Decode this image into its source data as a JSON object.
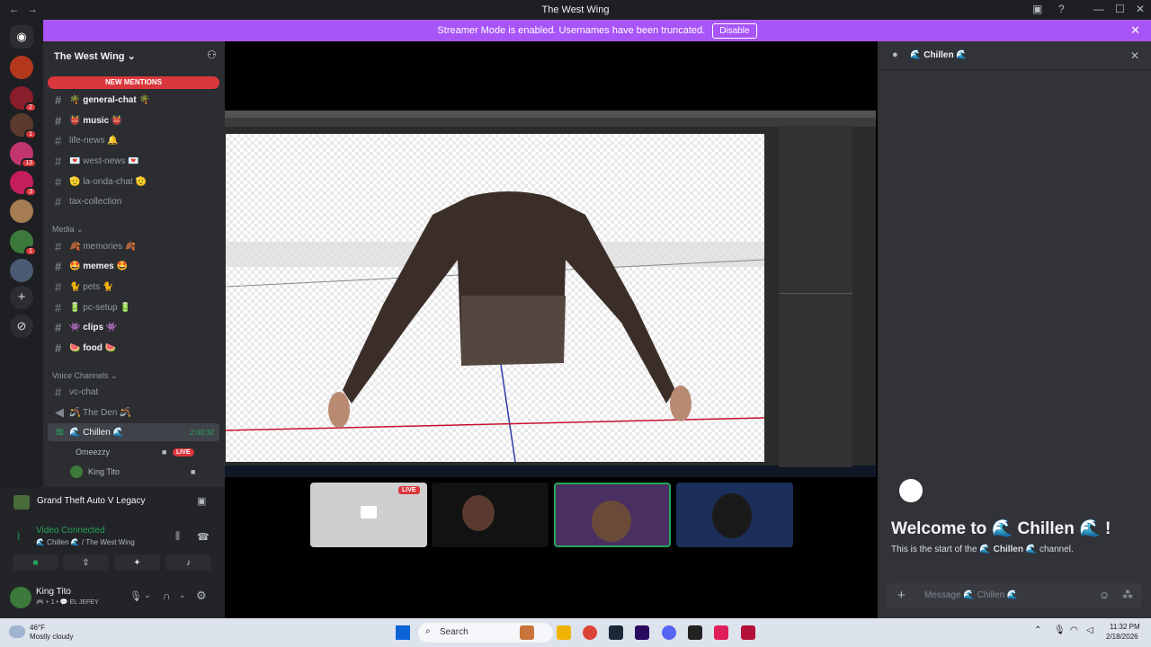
{
  "window": {
    "title": "The West Wing"
  },
  "banner": {
    "text": "Streamer Mode is enabled. Usernames have been truncated.",
    "button": "Disable"
  },
  "server": {
    "name": "The West Wing"
  },
  "new_mentions": "NEW MENTIONS",
  "channels": [
    {
      "name": "🌴 general-chat 🌴",
      "unread": true
    },
    {
      "name": "👹 music 👹",
      "unread": true
    },
    {
      "name": "life-news 🔔",
      "unread": false
    },
    {
      "name": "💌 west-news 💌",
      "unread": false
    },
    {
      "name": "🫡 la-onda-chat 🫡",
      "unread": false
    },
    {
      "name": "tax-collection",
      "unread": false
    }
  ],
  "media_category": "Media",
  "media_channels": [
    {
      "name": "🍂 memories 🍂",
      "unread": false
    },
    {
      "name": "🤩 memes 🤩",
      "unread": true
    },
    {
      "name": "🐈 pets 🐈",
      "unread": false
    },
    {
      "name": "🔋 pc-setup 🔋",
      "unread": false
    },
    {
      "name": "👾 clips 👾",
      "unread": true
    },
    {
      "name": "🍉 food 🍉",
      "unread": true
    }
  ],
  "voice_category": "Voice Channels",
  "voice_channels": [
    {
      "name": "vc-chat"
    },
    {
      "name": "🪃 The Den 🪃"
    },
    {
      "name": "🌊 Chillen 🌊",
      "timer": "2:00:32"
    }
  ],
  "voice_users": [
    {
      "name": "Omeezzy",
      "live": "LIVE"
    },
    {
      "name": "King Tito"
    }
  ],
  "activity": {
    "game": "Grand Theft Auto V Legacy"
  },
  "voice_status": {
    "title": "Video Connected",
    "channel": "🌊 Chillen 🌊 / The West Wing"
  },
  "user": {
    "name": "King Tito",
    "status": "🎮 + 1 • 💬 EL JEFEY"
  },
  "server_badges": [
    "2",
    "1",
    "13",
    "3",
    "1"
  ],
  "chat": {
    "channel": "🌊 Chillen 🌊",
    "welcome": "Welcome to 🌊 Chillen 🌊 !",
    "sub_prefix": "This is the start of the",
    "sub_channel": "🌊 Chillen 🌊",
    "sub_suffix": "channel.",
    "placeholder": "Message 🌊 Chillen 🌊"
  },
  "stream": {
    "live_label": "LIVE"
  },
  "taskbar": {
    "weather_temp": "46°F",
    "weather_desc": "Mostly cloudy",
    "search": "Search",
    "time": "11:32 PM",
    "date": "2/18/2026"
  },
  "colors": {
    "accent": "#a855f7",
    "live": "#da373c",
    "connected": "#23a559"
  }
}
